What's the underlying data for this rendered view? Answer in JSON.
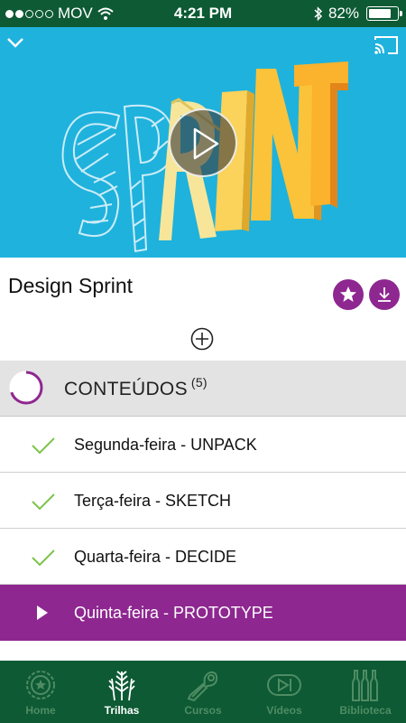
{
  "status_bar": {
    "carrier": "MOV",
    "time": "4:21 PM",
    "battery_percent": "82%",
    "battery_level": 0.82,
    "signal_bars_filled": 2
  },
  "video": {
    "play_icon": "play-icon",
    "collapse_icon": "chevron-down-icon",
    "cast_icon": "cast-icon"
  },
  "course": {
    "title": "Design Sprint",
    "favorite_icon": "star-icon",
    "download_icon": "download-icon",
    "add_icon": "plus-circle-icon"
  },
  "contents": {
    "title": "CONTEÚDOS",
    "count": "(5)",
    "progress": 0.7,
    "items": [
      {
        "label": "Segunda-feira - UNPACK",
        "status": "done"
      },
      {
        "label": "Terça-feira - SKETCH",
        "status": "done"
      },
      {
        "label": "Quarta-feira - DECIDE",
        "status": "done"
      },
      {
        "label": "Quinta-feira - PROTOTYPE",
        "status": "playing"
      }
    ]
  },
  "bottom_nav": {
    "items": [
      {
        "label": "Home",
        "icon": "beer-cap-icon",
        "active": false
      },
      {
        "label": "Trilhas",
        "icon": "wheat-icon",
        "active": true
      },
      {
        "label": "Cursos",
        "icon": "bottle-opener-icon",
        "active": false
      },
      {
        "label": "Vídeos",
        "icon": "video-icon",
        "active": false
      },
      {
        "label": "Biblioteca",
        "icon": "bottles-icon",
        "active": false
      }
    ]
  },
  "colors": {
    "brand_green": "#0d5a34",
    "accent_purple": "#8e2790",
    "check_green": "#7cc44a",
    "hero_blue": "#1fb2dd"
  }
}
